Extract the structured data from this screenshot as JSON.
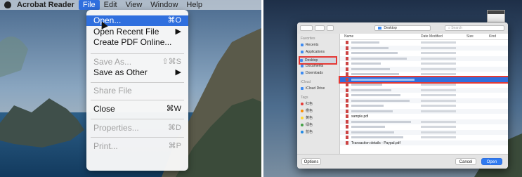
{
  "menubar": {
    "app": "Acrobat Reader",
    "items": [
      "File",
      "Edit",
      "View",
      "Window",
      "Help"
    ],
    "active": "File"
  },
  "file_menu": {
    "items": [
      {
        "label": "Open...",
        "shortcut": "⌘O",
        "selected": true,
        "disabled": false
      },
      {
        "label": "Open Recent File",
        "shortcut": "▶",
        "selected": false,
        "disabled": false
      },
      {
        "label": "Create PDF Online...",
        "shortcut": "",
        "selected": false,
        "disabled": false
      },
      {
        "label": "Save As...",
        "shortcut": "⇧⌘S",
        "selected": false,
        "disabled": true
      },
      {
        "label": "Save as Other",
        "shortcut": "▶",
        "selected": false,
        "disabled": false
      },
      {
        "label": "Share File",
        "shortcut": "",
        "selected": false,
        "disabled": true
      },
      {
        "label": "Close",
        "shortcut": "⌘W",
        "selected": false,
        "disabled": false
      },
      {
        "label": "Properties...",
        "shortcut": "⌘D",
        "selected": false,
        "disabled": true
      },
      {
        "label": "Print...",
        "shortcut": "⌘P",
        "selected": false,
        "disabled": true
      }
    ]
  },
  "dialog": {
    "location": "Desktop",
    "search_placeholder": "Search",
    "columns": [
      "Name",
      "Date Modified",
      "Size",
      "Kind"
    ],
    "sidebar": [
      {
        "label": "Favorites",
        "type": "header"
      },
      {
        "label": "Recents",
        "type": "item"
      },
      {
        "label": "Applications",
        "type": "item"
      },
      {
        "label": "Desktop",
        "type": "item",
        "highlight": true
      },
      {
        "label": "Documents",
        "type": "item"
      },
      {
        "label": "Downloads",
        "type": "item"
      },
      {
        "label": "iCloud",
        "type": "header"
      },
      {
        "label": "iCloud Drive",
        "type": "item"
      },
      {
        "label": "Tags",
        "type": "header"
      },
      {
        "label": "红色",
        "type": "tag",
        "color": "#e53935"
      },
      {
        "label": "橙色",
        "type": "tag",
        "color": "#fb8c00"
      },
      {
        "label": "黄色",
        "type": "tag",
        "color": "#fdd835"
      },
      {
        "label": "绿色",
        "type": "tag",
        "color": "#43a047"
      },
      {
        "label": "蓝色",
        "type": "tag",
        "color": "#1e88e5"
      }
    ],
    "files": [
      {
        "name": "",
        "date": "",
        "size": "",
        "kind": "",
        "style": "faded"
      },
      {
        "name": "",
        "date": "",
        "size": "",
        "kind": "",
        "style": "faded"
      },
      {
        "name": "",
        "date": "",
        "size": "",
        "kind": "",
        "style": "faded"
      },
      {
        "name": "",
        "date": "",
        "size": "",
        "kind": "",
        "style": "faded"
      },
      {
        "name": "",
        "date": "",
        "size": "",
        "kind": "",
        "style": "faded"
      },
      {
        "name": "",
        "date": "",
        "size": "",
        "kind": "",
        "style": "faded"
      },
      {
        "name": "",
        "date": "",
        "size": "",
        "kind": "",
        "style": "faded"
      },
      {
        "name": "",
        "date": "",
        "size": "",
        "kind": "",
        "style": "selected"
      },
      {
        "name": "",
        "date": "",
        "size": "",
        "kind": "",
        "style": "faded"
      },
      {
        "name": "",
        "date": "",
        "size": "",
        "kind": "",
        "style": "faded"
      },
      {
        "name": "",
        "date": "",
        "size": "",
        "kind": "",
        "style": "faded"
      },
      {
        "name": "",
        "date": "",
        "size": "",
        "kind": "",
        "style": "faded"
      },
      {
        "name": "",
        "date": "",
        "size": "",
        "kind": "",
        "style": "faded"
      },
      {
        "name": "",
        "date": "",
        "size": "",
        "kind": "",
        "style": "faded"
      },
      {
        "name": "sample.pdf",
        "date": "",
        "size": "",
        "kind": "",
        "style": "dark"
      },
      {
        "name": "",
        "date": "",
        "size": "",
        "kind": "",
        "style": "faded"
      },
      {
        "name": "",
        "date": "",
        "size": "",
        "kind": "",
        "style": "faded"
      },
      {
        "name": "",
        "date": "",
        "size": "",
        "kind": "",
        "style": "faded"
      },
      {
        "name": "",
        "date": "",
        "size": "",
        "kind": "",
        "style": "faded"
      },
      {
        "name": "Transaction details - Paypal.pdf",
        "date": "",
        "size": "",
        "kind": "",
        "style": "dark"
      }
    ],
    "options_label": "Options",
    "cancel_label": "Cancel",
    "open_label": "Open"
  },
  "colors": {
    "accent": "#2f6fde",
    "highlight_outline": "#e53935"
  }
}
